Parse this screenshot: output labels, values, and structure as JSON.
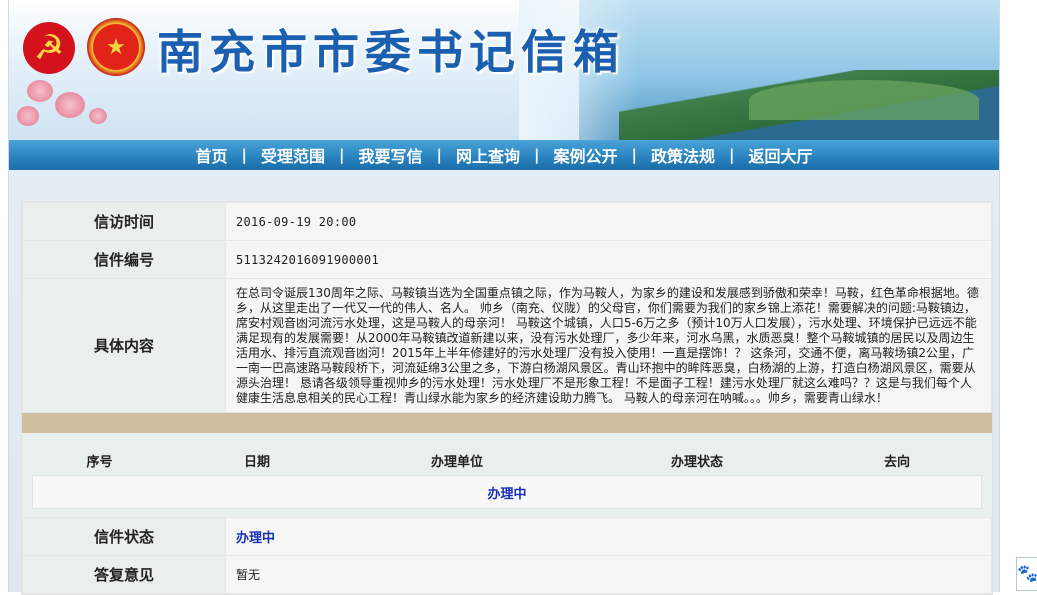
{
  "header": {
    "title": "南充市市委书记信箱",
    "party_emblem": "party-emblem-icon",
    "national_emblem": "national-emblem-icon"
  },
  "nav": {
    "items": [
      "首页",
      "受理范围",
      "我要写信",
      "网上查询",
      "案例公开",
      "政策法规",
      "返回大厅"
    ],
    "separator": "|"
  },
  "letter": {
    "time_label": "信访时间",
    "time_value": "2016-09-19 20:00",
    "number_label": "信件编号",
    "number_value": "5113242016091900001",
    "content_label": "具体内容",
    "content_value": "在总司令诞辰130周年之际、马鞍镇当选为全国重点镇之际，作为马鞍人，为家乡的建设和发展感到骄傲和荣幸！马鞍，红色革命根据地。德乡，从这里走出了一代又一代的伟人、名人。 帅乡（南充、仪陇）的父母官，你们需要为我们的家乡锦上添花！需要解决的问题:马鞍镇边，席安村观音凼河流污水处理，这是马鞍人的母亲河！ 马鞍这个城镇，人口5-6万之多（预计10万人口发展），污水处理、环境保护已远远不能满足现有的发展需要！从2000年马鞍镇改道新建以来，没有污水处理厂，多少年来，河水乌黑，水质恶臭！整个马鞍城镇的居民以及周边生活用水、排污直流观音凼河！2015年上半年修建好的污水处理厂没有投入使用！一直是摆饰！？ 这条河，交通不便，离马鞍场镇2公里，广一南一巴高速路马鞍段桥下，河流延绵3公里之多，下游白杨湖风景区。青山环抱中的眸阵恶臭，白杨湖的上游，打造白杨湖风景区，需要从源头治理！ 恳请各级领导重视帅乡的污水处理！污水处理厂不是形象工程！不是面子工程！建污水处理厂就这么难吗？？这是与我们每个人健康生活息息相关的民心工程！青山绿水能为家乡的经济建设助力腾飞。 马鞍人的母亲河在呐喊。。。帅乡，需要青山绿水！"
  },
  "process": {
    "headers": [
      "序号",
      "日期",
      "办理单位",
      "办理状态",
      "去向"
    ],
    "row_status": "办理中"
  },
  "status": {
    "label": "信件状态",
    "value": "办理中"
  },
  "reply": {
    "label": "答复意见",
    "value": "暂无"
  },
  "float_widget": {
    "icon": "paw-icon"
  },
  "colors": {
    "nav_blue": "#2a84c0",
    "title_blue": "#1b5fb0",
    "status_blue": "#1a2fb4",
    "tan_band": "#cfbd9b",
    "label_bg": "#e9efec"
  }
}
